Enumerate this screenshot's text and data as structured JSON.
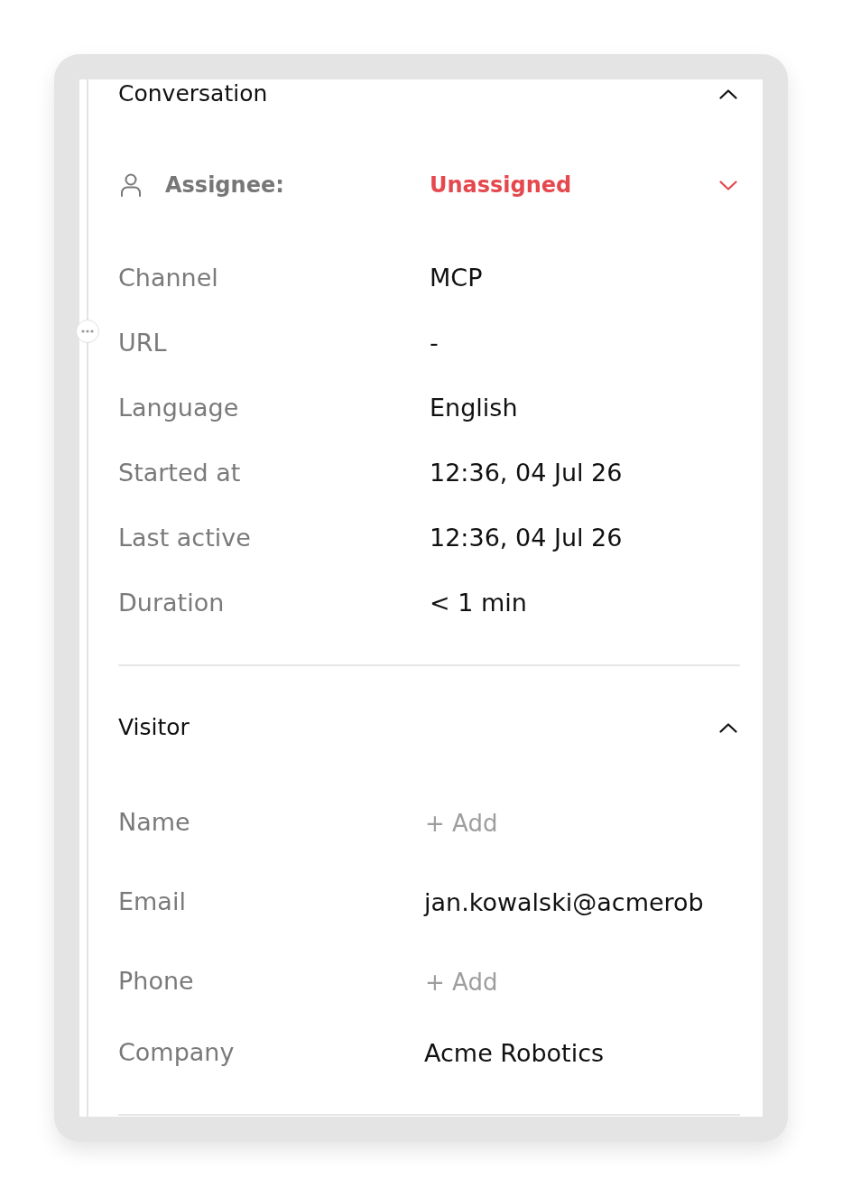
{
  "sections": [
    {
      "title": "Conversation",
      "expanded": true,
      "assignee": {
        "label": "Assignee:",
        "value": "Unassigned",
        "assigned": false
      },
      "fields": [
        {
          "label": "Channel",
          "value": "MCP",
          "kind": "text"
        },
        {
          "label": "URL",
          "value": "-",
          "kind": "text"
        },
        {
          "label": "Language",
          "value": "English",
          "kind": "text"
        },
        {
          "label": "Started at",
          "value": "12:36, 04 Jul 26",
          "kind": "text"
        },
        {
          "label": "Last active",
          "value": "12:36, 04 Jul 26",
          "kind": "text"
        },
        {
          "label": "Duration",
          "value": "< 1 min",
          "kind": "text"
        }
      ]
    },
    {
      "title": "Visitor",
      "expanded": true,
      "fields": [
        {
          "label": "Name",
          "value": "+ Add",
          "kind": "add"
        },
        {
          "label": "Email",
          "value": "jan.kowalski@acmerob",
          "kind": "input"
        },
        {
          "label": "Phone",
          "value": "+ Add",
          "kind": "add"
        },
        {
          "label": "Company",
          "value": "Acme Robotics",
          "kind": "input"
        }
      ]
    }
  ]
}
